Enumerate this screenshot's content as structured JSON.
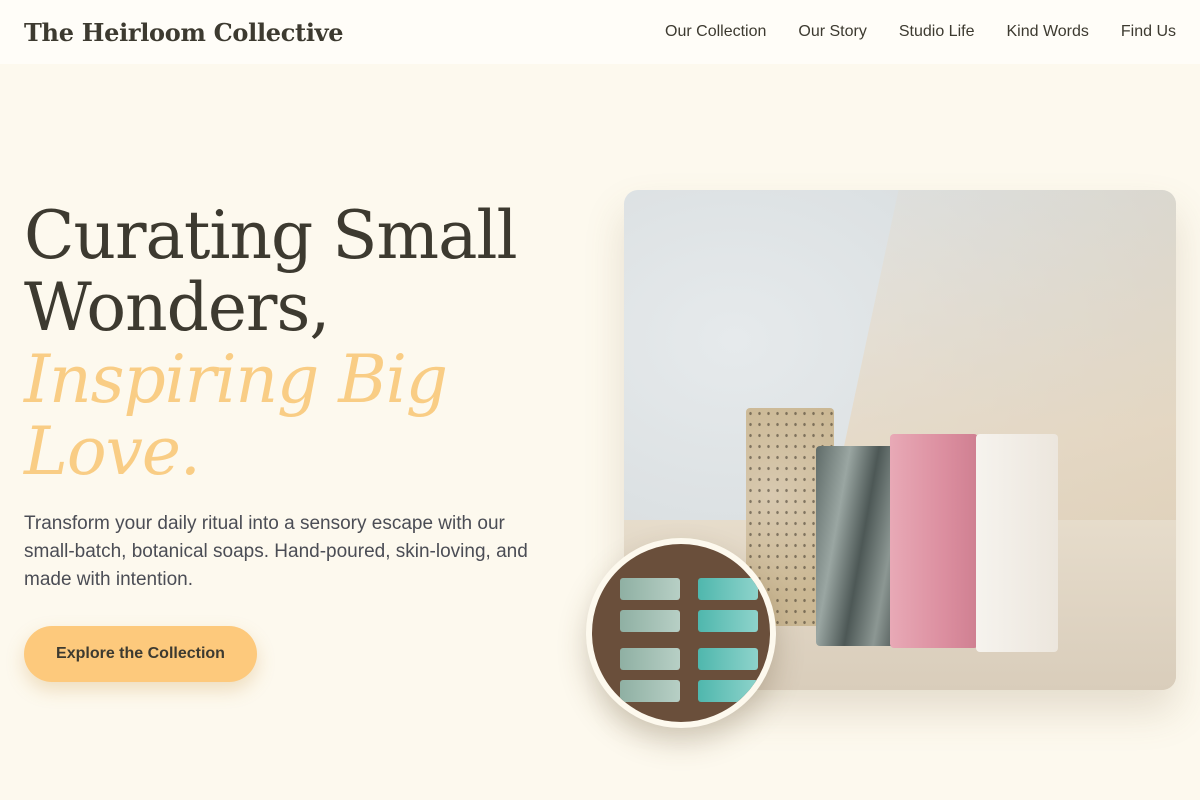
{
  "brand": "The Heirloom Collective",
  "nav": {
    "links": [
      "Our Collection",
      "Our Story",
      "Studio Life",
      "Kind Words",
      "Find Us"
    ]
  },
  "hero": {
    "headline_line1": "Curating Small",
    "headline_line2": "Wonders,",
    "accent_line1": "Inspiring Big",
    "accent_line2": "Love.",
    "lead": "Transform your daily ritual into a sensory escape with our small-batch, botanical soaps. Hand-poured, skin-loving, and made with intention.",
    "cta_label": "Explore the Collection"
  },
  "colors": {
    "background": "#fdf9ee",
    "accent": "#f9cd85",
    "cta": "#fdc97c",
    "text": "#3d3a30"
  },
  "images": {
    "main_photo": "handmade-soap-bars-photo",
    "round_photo": "soap-trays-photo"
  }
}
